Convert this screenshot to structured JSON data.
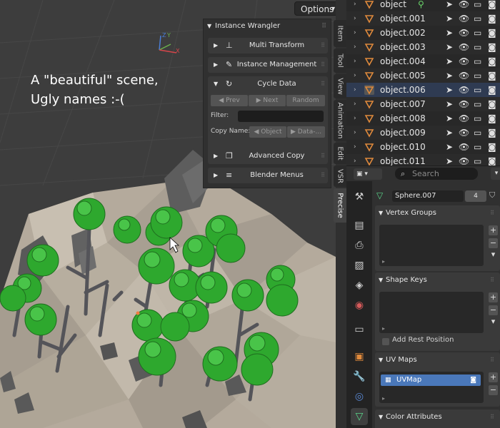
{
  "viewport": {
    "options_label": "Options",
    "overlay_text": [
      "A \"beautiful\" scene,",
      "Ugly names :-("
    ],
    "gizmo_axes": [
      "Z",
      "Y",
      "X"
    ]
  },
  "npanel": {
    "title": "Instance Wrangler",
    "multi_transform": "Multi Transform",
    "instance_management": "Instance Management",
    "cycle_data": "Cycle Data",
    "prev": "Prev",
    "next": "Next",
    "random": "Random",
    "filter_label": "Filter:",
    "filter_value": "",
    "copy_name_label": "Copy Name:",
    "copy_name_object": "Object",
    "copy_name_data": "Data-...",
    "advanced_copy": "Advanced Copy",
    "blender_menus": "Blender Menus"
  },
  "tabs": [
    "Item",
    "Tool",
    "View",
    "Animation",
    "Edit",
    "VSR",
    "Precise"
  ],
  "outliner": {
    "rows": [
      {
        "name": "object"
      },
      {
        "name": "object.001"
      },
      {
        "name": "object.002"
      },
      {
        "name": "object.003"
      },
      {
        "name": "object.004"
      },
      {
        "name": "object.005"
      },
      {
        "name": "object.006"
      },
      {
        "name": "object.007"
      },
      {
        "name": "object.008"
      },
      {
        "name": "object.009"
      },
      {
        "name": "object.010"
      },
      {
        "name": "object.011"
      }
    ]
  },
  "properties": {
    "search_placeholder": "Search",
    "mesh_name": "Sphere.007",
    "users": "4",
    "vertex_groups": "Vertex Groups",
    "shape_keys": "Shape Keys",
    "add_rest_position": "Add Rest Position",
    "uv_maps": "UV Maps",
    "uv_map_item": "UVMap",
    "color_attributes": "Color Attributes"
  },
  "colors": {
    "accent_blue": "#4a78ba",
    "mesh_icon": "#e08a3c",
    "tree_green": "#2ea82e",
    "viewport_bg": "#3d3d3d"
  }
}
